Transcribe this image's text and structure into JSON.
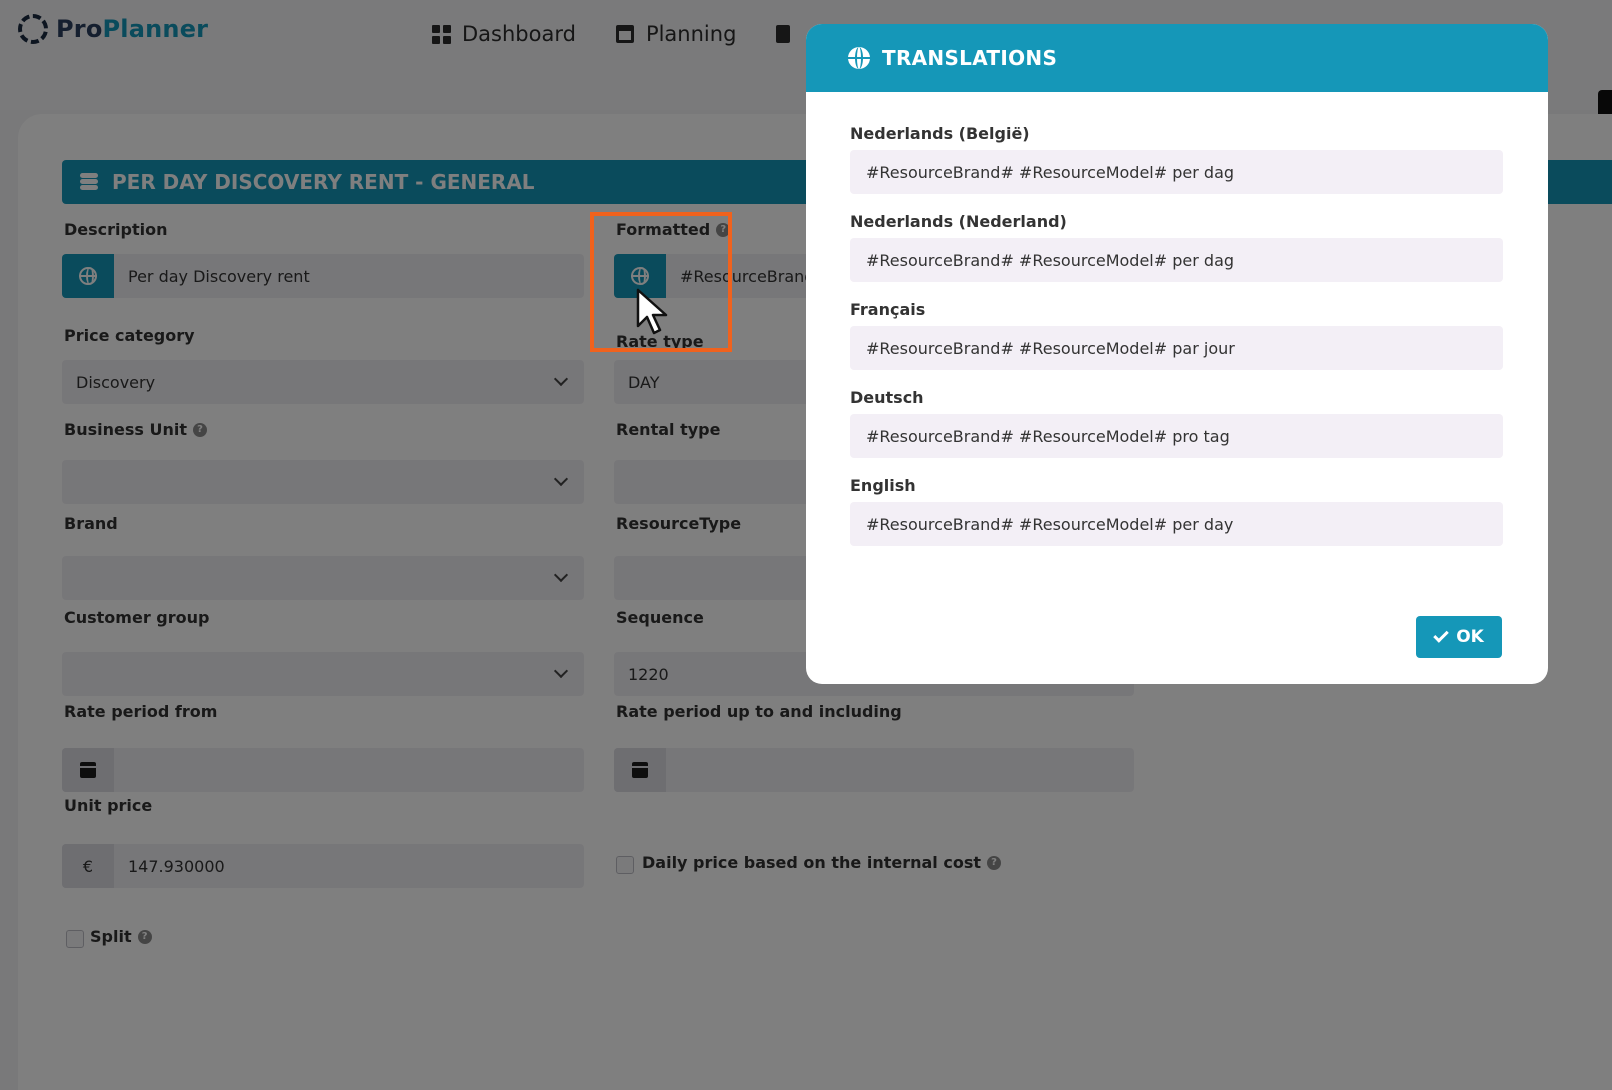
{
  "app": {
    "logo_pro": "Pro",
    "logo_planner": "Planner",
    "nav": [
      {
        "label": "Dashboard",
        "icon": "dashboard-icon"
      },
      {
        "label": "Planning",
        "icon": "calendar-icon"
      }
    ]
  },
  "form": {
    "section_title": "PER DAY DISCOVERY RENT - GENERAL",
    "description": {
      "label": "Description",
      "value": "Per day Discovery rent"
    },
    "formatted": {
      "label": "Formatted",
      "value": "#ResourceBrand"
    },
    "price_category": {
      "label": "Price category",
      "value": "Discovery"
    },
    "rate_type": {
      "label": "Rate type",
      "value": "DAY"
    },
    "business_unit": {
      "label": "Business Unit",
      "value": ""
    },
    "rental_type": {
      "label": "Rental type",
      "value": ""
    },
    "brand": {
      "label": "Brand",
      "value": ""
    },
    "resource_type": {
      "label": "ResourceType",
      "value": ""
    },
    "customer_group": {
      "label": "Customer group",
      "value": ""
    },
    "sequence": {
      "label": "Sequence",
      "value": "1220"
    },
    "rate_period_from": {
      "label": "Rate period from",
      "value": ""
    },
    "rate_period_to": {
      "label": "Rate period up to and including",
      "value": ""
    },
    "unit_price": {
      "label": "Unit price",
      "currency": "€",
      "value": "147.930000"
    },
    "daily_price_internal": {
      "label": "Daily price based on the internal cost",
      "checked": false
    },
    "split": {
      "label": "Split",
      "checked": false
    }
  },
  "modal": {
    "title": "TRANSLATIONS",
    "translations": [
      {
        "language": "Nederlands (België)",
        "value": "#ResourceBrand# #ResourceModel# per dag"
      },
      {
        "language": "Nederlands (Nederland)",
        "value": "#ResourceBrand# #ResourceModel# per dag"
      },
      {
        "language": "Français",
        "value": "#ResourceBrand# #ResourceModel# par jour"
      },
      {
        "language": "Deutsch",
        "value": "#ResourceBrand# #ResourceModel# pro tag"
      },
      {
        "language": "English",
        "value": "#ResourceBrand# #ResourceModel# per day"
      }
    ],
    "ok_label": "OK"
  },
  "colors": {
    "accent": "#1597b8",
    "highlight": "#f0621d",
    "logo_dark": "#2a3f5f"
  }
}
